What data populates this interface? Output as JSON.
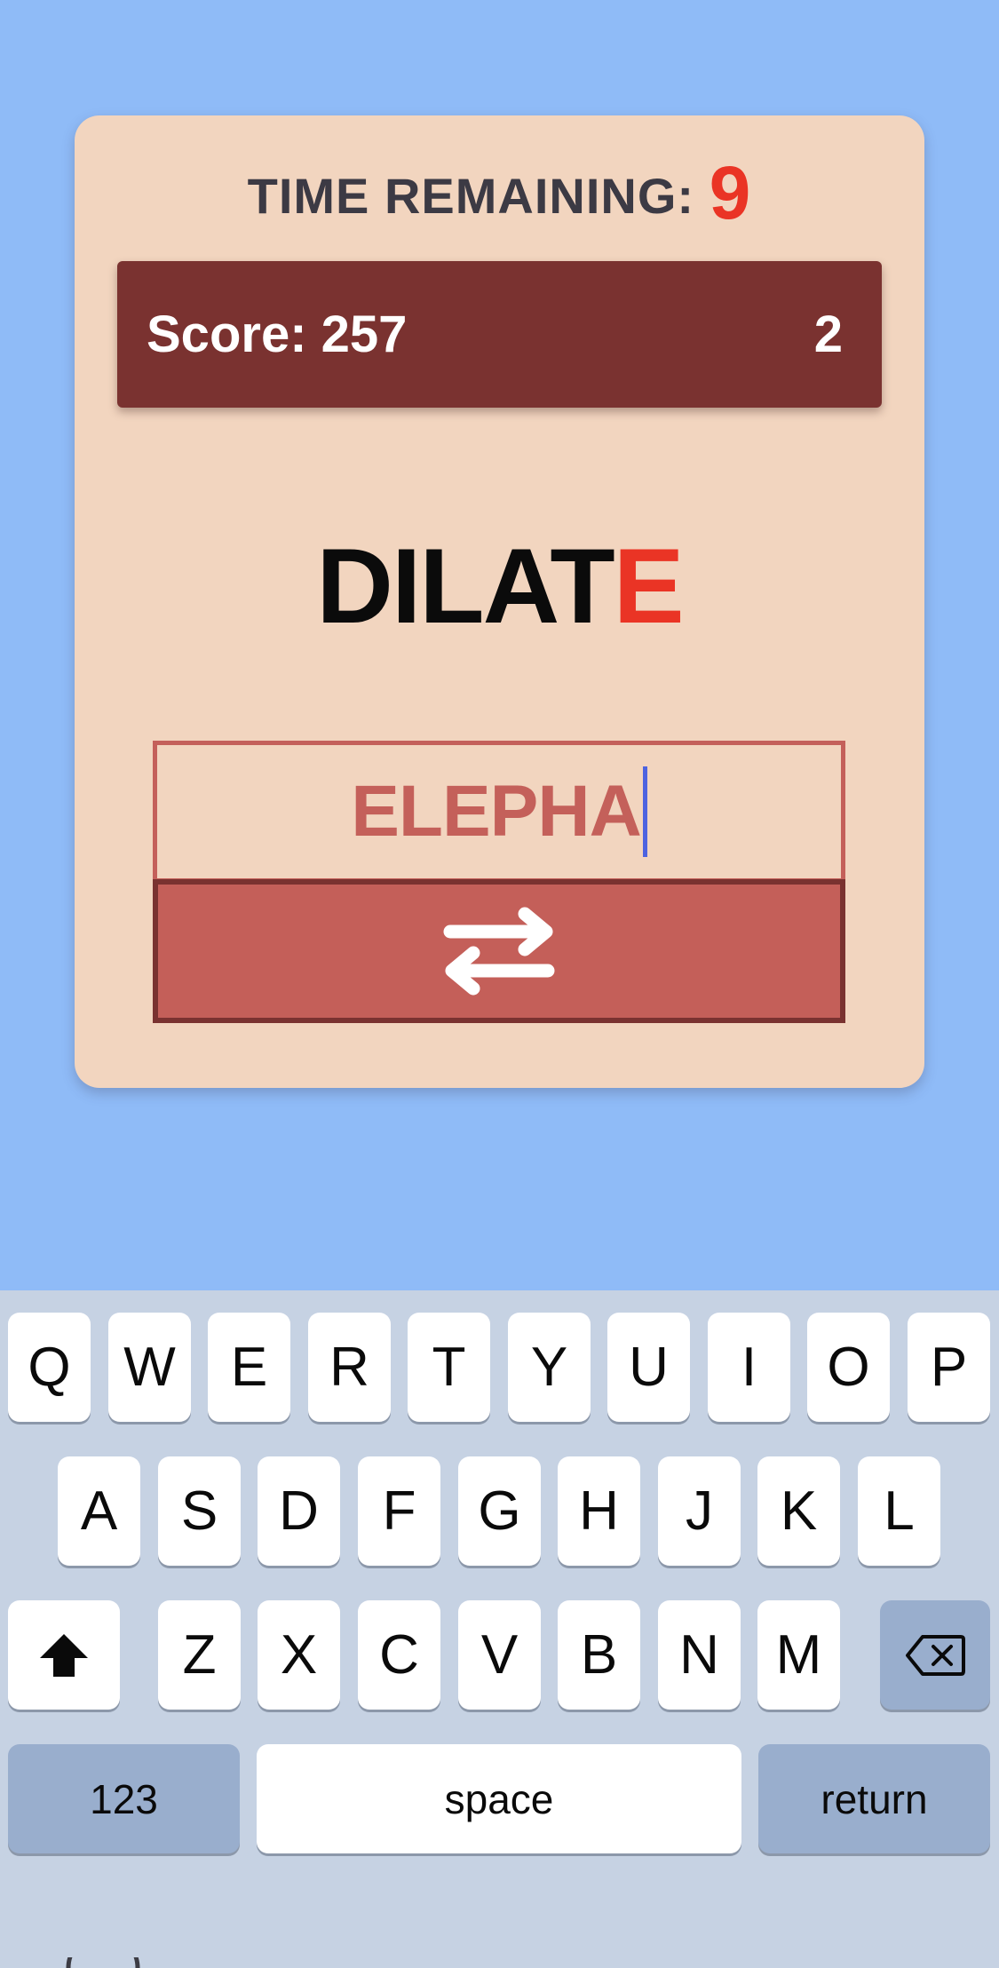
{
  "timer": {
    "label": "TIME REMAINING:",
    "value": "9"
  },
  "score": {
    "label": "Score: 257",
    "right_value": "2"
  },
  "word": {
    "base": "DILAT",
    "highlighted": "E"
  },
  "guess": {
    "value": "ELEPHA"
  },
  "swap_button": {
    "icon": "swap-arrows-icon"
  },
  "colors": {
    "background": "#8fbbf7",
    "card": "#f2d5bf",
    "score_bar": "#7a3230",
    "accent_red": "#ea3425",
    "input_text": "#c4605a",
    "caret": "#4d63e0"
  },
  "keyboard": {
    "row1": [
      "Q",
      "W",
      "E",
      "R",
      "T",
      "Y",
      "U",
      "I",
      "O",
      "P"
    ],
    "row2": [
      "A",
      "S",
      "D",
      "F",
      "G",
      "H",
      "J",
      "K",
      "L"
    ],
    "row3": [
      "Z",
      "X",
      "C",
      "V",
      "B",
      "N",
      "M"
    ],
    "numbers_label": "123",
    "space_label": "space",
    "return_label": "return",
    "shift_icon": "shift-icon",
    "delete_icon": "delete-icon",
    "emoji_icon": "emoji-icon"
  }
}
